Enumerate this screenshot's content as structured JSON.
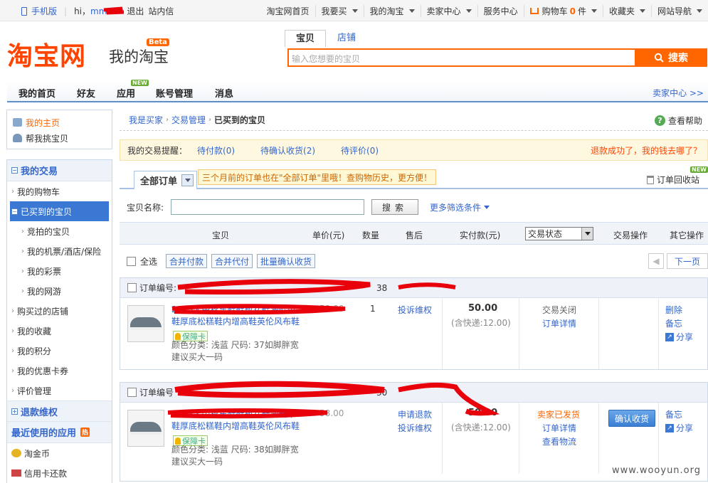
{
  "topbar": {
    "mobile": "手机版",
    "hi": "hi，",
    "user": "mm",
    "logout": "退出",
    "inbox": "站内信",
    "links": [
      {
        "label": "淘宝网首页",
        "caret": false
      },
      {
        "label": "我要买",
        "caret": true
      },
      {
        "label": "我的淘宝",
        "caret": true
      },
      {
        "label": "卖家中心",
        "caret": true
      },
      {
        "label": "服务中心",
        "caret": false
      },
      {
        "label": "购物车",
        "caret": true,
        "count": "0",
        "unit": "件"
      },
      {
        "label": "收藏夹",
        "caret": true
      },
      {
        "label": "网站导航",
        "caret": true
      }
    ]
  },
  "header": {
    "logo": "淘宝网",
    "logo_sub": "我的淘宝",
    "beta": "Beta",
    "search_tabs": [
      "宝贝",
      "店铺"
    ],
    "search_placeholder": "输入您想要的宝贝",
    "search_button": "搜索"
  },
  "nav": {
    "items": [
      "我的首页",
      "好友",
      "应用",
      "账号管理",
      "消息"
    ],
    "new_badge": "NEW",
    "seller_center": "卖家中心 >>"
  },
  "sidebar": {
    "top": [
      "我的主页",
      "帮我挑宝贝"
    ],
    "my_trade": "我的交易",
    "trade_items": [
      {
        "label": "我的购物车",
        "level": 1
      },
      {
        "label": "已买到的宝贝",
        "level": 1,
        "active": true
      },
      {
        "label": "竞拍的宝贝",
        "level": 2
      },
      {
        "label": "我的机票/酒店/保险",
        "level": 2
      },
      {
        "label": "我的彩票",
        "level": 2
      },
      {
        "label": "我的网游",
        "level": 2
      },
      {
        "label": "购买过的店铺",
        "level": 1
      },
      {
        "label": "我的收藏",
        "level": 1
      },
      {
        "label": "我的积分",
        "level": 1
      },
      {
        "label": "我的优惠卡券",
        "level": 1
      },
      {
        "label": "评价管理",
        "level": 1
      }
    ],
    "refund": "退款维权",
    "recent_apps": "最近使用的应用",
    "hot": "热",
    "apps": [
      "淘金币",
      "信用卡还款"
    ]
  },
  "breadcrumb": {
    "items": [
      "我是买家",
      "交易管理",
      "已买到的宝贝"
    ],
    "help": "查看帮助"
  },
  "reminder": {
    "label": "我的交易提醒：",
    "items": [
      "待付款(0)",
      "待确认收货(2)",
      "待评价(0)"
    ],
    "refund_link": "退款成功了，我的钱去哪了？"
  },
  "tabs": {
    "all_orders": "全部订单",
    "tip": "三个月前的订单也在\"全部订单\"里哦！查购物历史，更方便！",
    "recycle": "订单回收站",
    "new_badge": "NEW"
  },
  "filter": {
    "label": "宝贝名称:",
    "search_button": "搜索",
    "more": "更多筛选条件"
  },
  "table": {
    "headers": [
      "宝贝",
      "单价(元)",
      "数量",
      "售后",
      "实付款(元)",
      "交易状态",
      "交易操作",
      "其它操作"
    ]
  },
  "bulk": {
    "select_all": "全选",
    "buttons": [
      "合并付款",
      "合并代付",
      "批量确认收货"
    ],
    "next_page": "下一页"
  },
  "orders": [
    {
      "order_label": "订单编号:",
      "order_time_tail": "38",
      "title_line1": "2013大中秋东鞋鞋板女鞋潮鞋单",
      "title_line2": "鞋厚底松糕鞋内增高鞋英伦风布鞋",
      "guarantee": "保障卡",
      "attr1": "颜色分类: 浅蓝 尺码: 37如脚胖宽",
      "attr2": "建议买大一码",
      "price": "58.00",
      "qty": "1",
      "after_sale": [
        "投诉维权"
      ],
      "total": "50.00",
      "shipping": "(含快递:12.00)",
      "status": [
        "交易关闭",
        "订单详情"
      ],
      "ops": [],
      "other": [
        "删除",
        "备忘",
        "分享"
      ]
    },
    {
      "order_label": "订单编号",
      "order_time_tail": "30",
      "title_line1": "2013大中秋东鞋鞋板女鞋潮鞋单",
      "title_line2": "鞋厚底松糕鞋内增高鞋英伦风布鞋",
      "guarantee": "保障卡",
      "attr1": "颜色分类: 浅蓝 尺码: 38如脚胖宽",
      "attr2": "建议买大一码",
      "price": "58.00",
      "qty": "1",
      "after_sale": [
        "申请退款",
        "投诉维权"
      ],
      "total": "50.00",
      "shipping": "(含快递:12.00)",
      "status": [
        "卖家已发货",
        "订单详情",
        "查看物流"
      ],
      "ops": [
        "确认收货"
      ],
      "other": [
        "备忘",
        "分享"
      ]
    }
  ],
  "colors": {
    "brand": "#ff4400",
    "link": "#3366cc",
    "scribble": "#e8000b",
    "status_shipped": "#ff6600"
  },
  "watermark": "www.wooyun.org"
}
